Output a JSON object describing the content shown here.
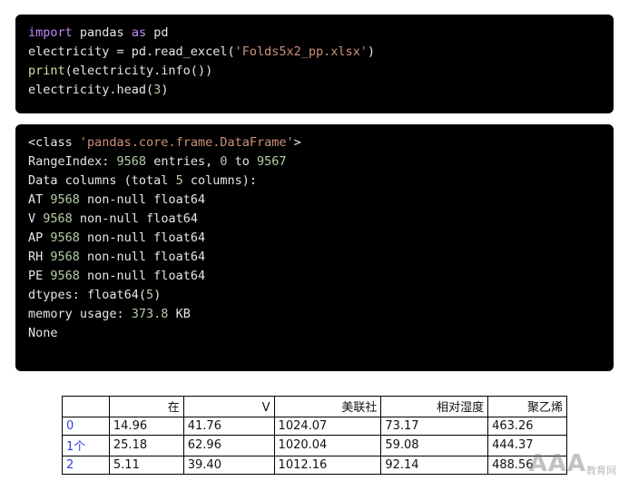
{
  "input_cell": {
    "lines": [
      [
        {
          "t": "import",
          "c": "kw"
        },
        {
          "t": " pandas ",
          "c": "plain"
        },
        {
          "t": "as",
          "c": "kw"
        },
        {
          "t": " pd",
          "c": "plain"
        }
      ],
      [
        {
          "t": "electricity = pd.read_excel(",
          "c": "plain"
        },
        {
          "t": "'Folds5x2_pp.xlsx'",
          "c": "str"
        },
        {
          "t": ")",
          "c": "plain"
        }
      ],
      [
        {
          "t": "print",
          "c": "fn"
        },
        {
          "t": "(electricity.info())",
          "c": "plain"
        }
      ],
      [
        {
          "t": "electricity.head(",
          "c": "plain"
        },
        {
          "t": "3",
          "c": "num"
        },
        {
          "t": ")",
          "c": "plain"
        }
      ]
    ]
  },
  "output_cell": {
    "lines": [
      [
        {
          "t": "<class ",
          "c": "plain"
        },
        {
          "t": "'pandas.core.frame.DataFrame'",
          "c": "str"
        },
        {
          "t": ">",
          "c": "plain"
        }
      ],
      [
        {
          "t": "RangeIndex: ",
          "c": "plain"
        },
        {
          "t": "9568",
          "c": "num"
        },
        {
          "t": " entries, ",
          "c": "plain"
        },
        {
          "t": "0",
          "c": "num"
        },
        {
          "t": " to ",
          "c": "plain"
        },
        {
          "t": "9567",
          "c": "num"
        }
      ],
      [
        {
          "t": "Data columns (total ",
          "c": "plain"
        },
        {
          "t": "5",
          "c": "num"
        },
        {
          "t": " columns):",
          "c": "plain"
        }
      ],
      [
        {
          "t": "AT ",
          "c": "plain"
        },
        {
          "t": "9568",
          "c": "num"
        },
        {
          "t": " non-null float64",
          "c": "plain"
        }
      ],
      [
        {
          "t": "V ",
          "c": "plain"
        },
        {
          "t": "9568",
          "c": "num"
        },
        {
          "t": " non-null float64",
          "c": "plain"
        }
      ],
      [
        {
          "t": "AP ",
          "c": "plain"
        },
        {
          "t": "9568",
          "c": "num"
        },
        {
          "t": " non-null float64",
          "c": "plain"
        }
      ],
      [
        {
          "t": "RH ",
          "c": "plain"
        },
        {
          "t": "9568",
          "c": "num"
        },
        {
          "t": " non-null float64",
          "c": "plain"
        }
      ],
      [
        {
          "t": "PE ",
          "c": "plain"
        },
        {
          "t": "9568",
          "c": "num"
        },
        {
          "t": " non-null float64",
          "c": "plain"
        }
      ],
      [
        {
          "t": "dtypes: float64(",
          "c": "plain"
        },
        {
          "t": "5",
          "c": "num"
        },
        {
          "t": ")",
          "c": "plain"
        }
      ],
      [
        {
          "t": "memory usage: ",
          "c": "plain"
        },
        {
          "t": "373.8",
          "c": "num"
        },
        {
          "t": " KB",
          "c": "plain"
        }
      ],
      [
        {
          "t": "None",
          "c": "plain"
        }
      ]
    ]
  },
  "table": {
    "headers": [
      "",
      "在",
      "V",
      "美联社",
      "相对湿度",
      "聚乙烯"
    ],
    "rows": [
      {
        "index": "0",
        "values": [
          "14.96",
          "41.76",
          "1024.07",
          "73.17",
          "463.26"
        ]
      },
      {
        "index": "1个",
        "values": [
          "25.18",
          "62.96",
          "1020.04",
          "59.08",
          "444.37"
        ]
      },
      {
        "index": "2",
        "values": [
          "5.11",
          "39.40",
          "1012.16",
          "92.14",
          "488.56"
        ]
      }
    ]
  },
  "watermark": {
    "main": "AAA",
    "sub": "教育网"
  }
}
